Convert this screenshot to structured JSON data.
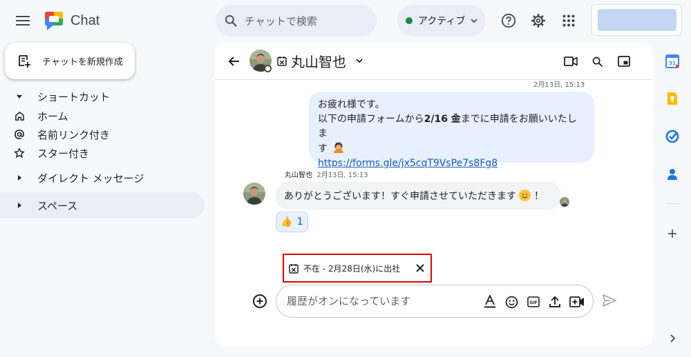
{
  "app": {
    "name": "Chat"
  },
  "search": {
    "placeholder": "チャットで検索"
  },
  "status": {
    "label": "アクティブ",
    "color": "#1e8e3e"
  },
  "icons": {
    "menu": "hamburger-menu-icon",
    "help": "help-icon",
    "settings": "gear-icon",
    "apps": "apps-grid-icon"
  },
  "sidebar": {
    "new_chat_label": "チャットを新規作成",
    "items": [
      {
        "label": "ショートカット",
        "icon": "caret-down-icon"
      },
      {
        "label": "ホーム",
        "icon": "home-icon"
      },
      {
        "label": "名前リンク付き",
        "icon": "at-icon"
      },
      {
        "label": "スター付き",
        "icon": "star-icon"
      },
      {
        "label": "ダイレクト メッセージ",
        "icon": "caret-right-icon"
      },
      {
        "label": "スペース",
        "icon": "caret-right-icon"
      }
    ]
  },
  "conversation": {
    "name": "丸山智也",
    "messages": [
      {
        "direction": "outgoing",
        "timestamp": "2月13日, 15:13",
        "line1": "お疲れ様です。",
        "line2_prefix": "以下の申請フォームから",
        "line2_bold": "2/16 金",
        "line2_suffix": "までに申請をお願いいたしま",
        "line3": "す",
        "link": "https://forms.gle/jx5cqT9VsPe7s8Fg8"
      },
      {
        "direction": "incoming",
        "sender": "丸山智也",
        "timestamp": "2月13日, 15:13",
        "text_before": "ありがとうございます！すぐ申請させていただきます",
        "text_after": "！",
        "reaction": {
          "emoji": "👍",
          "count": "1"
        }
      }
    ]
  },
  "ooo_banner": {
    "text": "不在 - 2月28日(水)に出社"
  },
  "composer": {
    "placeholder": "履歴がオンになっています"
  },
  "colors": {
    "accent": "#0b57d0",
    "highlight_border": "#e00000",
    "outgoing_bubble": "#e8f0fe"
  }
}
